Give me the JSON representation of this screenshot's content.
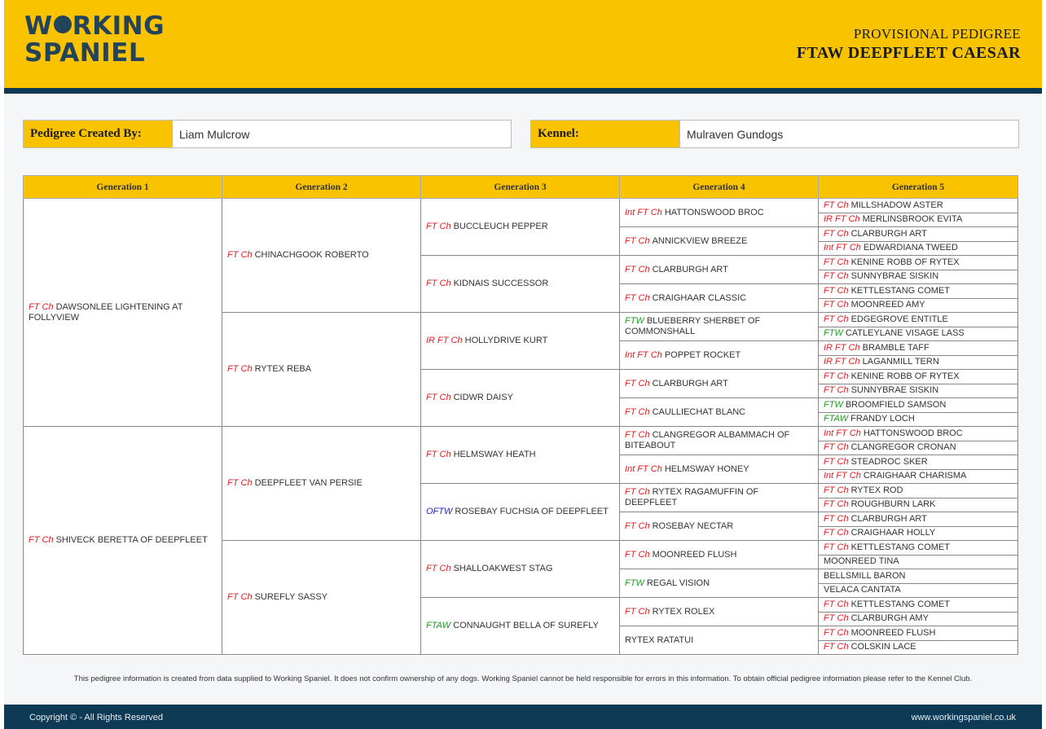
{
  "header": {
    "logo_line1_a": "W",
    "logo_line1_b": "RKING",
    "logo_line2": "SPANIEL",
    "subtitle": "PROVISIONAL PEDIGREE",
    "title": "FTAW DEEPFLEET CAESAR"
  },
  "info": {
    "creator_label": "Pedigree Created By:",
    "creator_value": "Liam Mulcrow",
    "kennel_label": "Kennel:",
    "kennel_value": "Mulraven Gundogs"
  },
  "colors": {
    "accent": "#f9c300",
    "navy": "#0e3a55",
    "title_red": "#e21c1c",
    "title_green": "#1f9a1f",
    "title_blue": "#2323c8"
  },
  "pedigree": {
    "headers": [
      "Generation 1",
      "Generation 2",
      "Generation 3",
      "Generation 4",
      "Generation 5"
    ],
    "gen1": [
      {
        "title": "FT Ch",
        "color": "red",
        "name": "DAWSONLEE LIGHTENING AT FOLLYVIEW"
      },
      {
        "title": "FT Ch",
        "color": "red",
        "name": "SHIVECK BERETTA OF DEEPFLEET"
      }
    ],
    "gen2": [
      {
        "title": "FT Ch",
        "color": "red",
        "name": "CHINACHGOOK ROBERTO"
      },
      {
        "title": "FT Ch",
        "color": "red",
        "name": "RYTEX REBA"
      },
      {
        "title": "FT Ch",
        "color": "red",
        "name": "DEEPFLEET VAN PERSIE"
      },
      {
        "title": "FT Ch",
        "color": "red",
        "name": "SUREFLY SASSY"
      }
    ],
    "gen3": [
      {
        "title": "FT Ch",
        "color": "red",
        "name": "BUCCLEUCH PEPPER"
      },
      {
        "title": "FT Ch",
        "color": "red",
        "name": "KIDNAIS SUCCESSOR"
      },
      {
        "title": "IR FT Ch",
        "color": "red",
        "name": "HOLLYDRIVE KURT"
      },
      {
        "title": "FT Ch",
        "color": "red",
        "name": "CIDWR DAISY"
      },
      {
        "title": "FT Ch",
        "color": "red",
        "name": "HELMSWAY HEATH"
      },
      {
        "title": "OFTW",
        "color": "blue",
        "name": "ROSEBAY FUCHSIA OF DEEPFLEET"
      },
      {
        "title": "FT Ch",
        "color": "red",
        "name": "SHALLOAKWEST STAG"
      },
      {
        "title": "FTAW",
        "color": "green",
        "name": "CONNAUGHT BELLA OF SUREFLY"
      }
    ],
    "gen4": [
      {
        "title": "Int FT Ch",
        "color": "red",
        "name": "HATTONSWOOD BROC"
      },
      {
        "title": "FT Ch",
        "color": "red",
        "name": "ANNICKVIEW BREEZE"
      },
      {
        "title": "FT Ch",
        "color": "red",
        "name": "CLARBURGH ART"
      },
      {
        "title": "FT Ch",
        "color": "red",
        "name": "CRAIGHAAR CLASSIC"
      },
      {
        "title": "FTW",
        "color": "green",
        "name": "BLUEBERRY SHERBET OF COMMONSHALL"
      },
      {
        "title": "Int FT Ch",
        "color": "red",
        "name": "POPPET ROCKET"
      },
      {
        "title": "FT Ch",
        "color": "red",
        "name": "CLARBURGH ART"
      },
      {
        "title": "FT Ch",
        "color": "red",
        "name": "CAULLIECHAT BLANC"
      },
      {
        "title": "FT Ch",
        "color": "red",
        "name": "CLANGREGOR ALBAMMACH OF BITEABOUT"
      },
      {
        "title": "Int FT Ch",
        "color": "red",
        "name": "HELMSWAY HONEY"
      },
      {
        "title": "FT Ch",
        "color": "red",
        "name": "RYTEX RAGAMUFFIN OF DEEPFLEET"
      },
      {
        "title": "FT Ch",
        "color": "red",
        "name": "ROSEBAY NECTAR"
      },
      {
        "title": "FT Ch",
        "color": "red",
        "name": "MOONREED FLUSH"
      },
      {
        "title": "FTW",
        "color": "green",
        "name": "REGAL VISION"
      },
      {
        "title": "FT Ch",
        "color": "red",
        "name": "RYTEX ROLEX"
      },
      {
        "title": "",
        "color": "none",
        "name": "RYTEX RATATUI"
      }
    ],
    "gen5": [
      {
        "title": "FT Ch",
        "color": "red",
        "name": "MILLSHADOW ASTER"
      },
      {
        "title": "IR FT Ch",
        "color": "red",
        "name": "MERLINSBROOK EVITA"
      },
      {
        "title": "FT Ch",
        "color": "red",
        "name": "CLARBURGH ART"
      },
      {
        "title": "Int FT Ch",
        "color": "red",
        "name": "EDWARDIANA TWEED"
      },
      {
        "title": "FT Ch",
        "color": "red",
        "name": "KENINE ROBB OF RYTEX"
      },
      {
        "title": "FT Ch",
        "color": "red",
        "name": "SUNNYBRAE SISKIN"
      },
      {
        "title": "FT Ch",
        "color": "red",
        "name": "KETTLESTANG COMET"
      },
      {
        "title": "FT Ch",
        "color": "red",
        "name": "MOONREED AMY"
      },
      {
        "title": "FT Ch",
        "color": "red",
        "name": "EDGEGROVE ENTITLE"
      },
      {
        "title": "FTW",
        "color": "green",
        "name": "CATLEYLANE VISAGE LASS"
      },
      {
        "title": "IR FT Ch",
        "color": "red",
        "name": "BRAMBLE TAFF"
      },
      {
        "title": "IR FT Ch",
        "color": "red",
        "name": "LAGANMILL TERN"
      },
      {
        "title": "FT Ch",
        "color": "red",
        "name": "KENINE ROBB OF RYTEX"
      },
      {
        "title": "FT Ch",
        "color": "red",
        "name": "SUNNYBRAE SISKIN"
      },
      {
        "title": "FTW",
        "color": "green",
        "name": "BROOMFIELD SAMSON"
      },
      {
        "title": "FTAW",
        "color": "green",
        "name": "FRANDY LOCH"
      },
      {
        "title": "Int FT Ch",
        "color": "red",
        "name": "HATTONSWOOD BROC"
      },
      {
        "title": "FT Ch",
        "color": "red",
        "name": "CLANGREGOR CRONAN"
      },
      {
        "title": "FT Ch",
        "color": "red",
        "name": "STEADROC SKER"
      },
      {
        "title": "Int FT Ch",
        "color": "red",
        "name": "CRAIGHAAR CHARISMA"
      },
      {
        "title": "FT Ch",
        "color": "red",
        "name": "RYTEX ROD"
      },
      {
        "title": "FT Ch",
        "color": "red",
        "name": "ROUGHBURN LARK"
      },
      {
        "title": "FT Ch",
        "color": "red",
        "name": "CLARBURGH ART"
      },
      {
        "title": "FT Ch",
        "color": "red",
        "name": "CRAIGHAAR HOLLY"
      },
      {
        "title": "FT Ch",
        "color": "red",
        "name": "KETTLESTANG COMET"
      },
      {
        "title": "",
        "color": "none",
        "name": "MOONREED TINA"
      },
      {
        "title": "",
        "color": "none",
        "name": "BELLSMILL BARON"
      },
      {
        "title": "",
        "color": "none",
        "name": "VELACA CANTATA"
      },
      {
        "title": "FT Ch",
        "color": "red",
        "name": "KETTLESTANG COMET"
      },
      {
        "title": "FT Ch",
        "color": "red",
        "name": "CLARBURGH AMY"
      },
      {
        "title": "FT Ch",
        "color": "red",
        "name": "MOONREED FLUSH"
      },
      {
        "title": "FT Ch",
        "color": "red",
        "name": "COLSKIN LACE"
      }
    ]
  },
  "footer": {
    "disclaimer": "This pedigree information is created from data supplied to Working Spaniel. It does not confirm ownership of any dogs. Working Spaniel cannot be held responsible for errors in this information. To obtain official pedigree information please refer to the Kennel Club.",
    "copyright": "Copyright © - All Rights Reserved",
    "url": "www.workingspaniel.co.uk"
  }
}
